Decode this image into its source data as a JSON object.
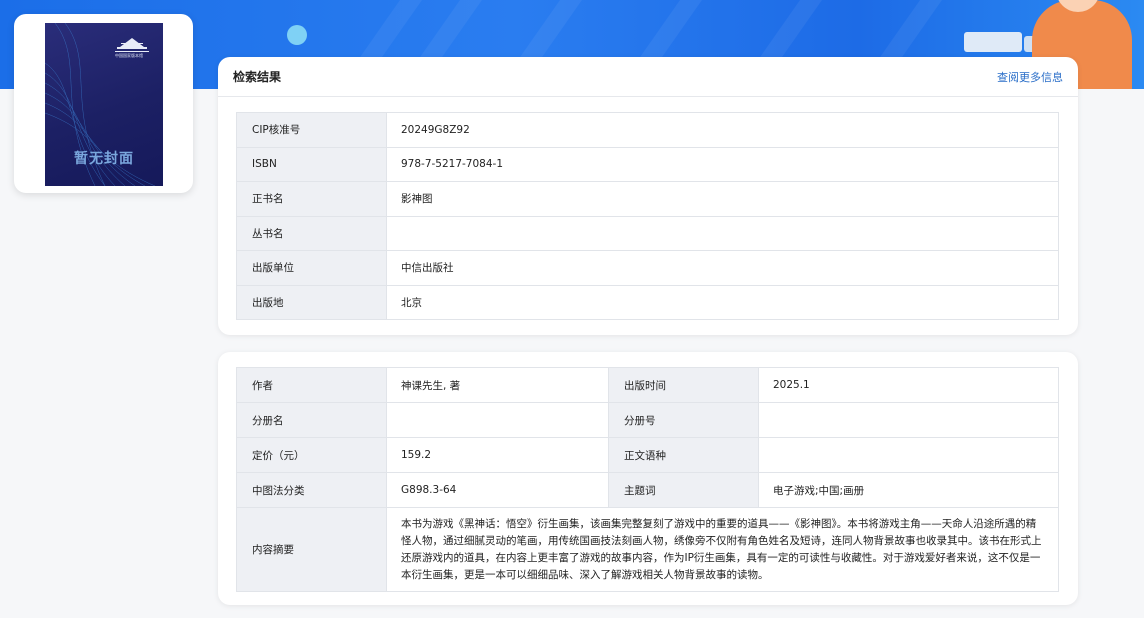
{
  "cover": {
    "placeholder_text": "暂无封面",
    "logo_text": "中国国家版本馆"
  },
  "results": {
    "title": "检索结果",
    "more_link": "查阅更多信息",
    "rows": [
      {
        "label": "CIP核准号",
        "value": "20249G8Z92"
      },
      {
        "label": "ISBN",
        "value": "978-7-5217-7084-1"
      },
      {
        "label": "正书名",
        "value": "影神图"
      },
      {
        "label": "丛书名",
        "value": ""
      },
      {
        "label": "出版单位",
        "value": "中信出版社"
      },
      {
        "label": "出版地",
        "value": "北京"
      }
    ]
  },
  "details": {
    "author_label": "作者",
    "author": "神课先生, 著",
    "pubdate_label": "出版时间",
    "pubdate": "2025.1",
    "volume_name_label": "分册名",
    "volume_name": "",
    "volume_no_label": "分册号",
    "volume_no": "",
    "price_label": "定价（元）",
    "price": "159.2",
    "language_label": "正文语种",
    "language": "",
    "clc_label": "中图法分类",
    "clc": "G898.3-64",
    "subject_label": "主题词",
    "subject": "电子游戏;中国;画册",
    "abstract_label": "内容摘要",
    "abstract": "本书为游戏《黑神话：悟空》衍生画集，该画集完整复刻了游戏中的重要的道具——《影神图》。本书将游戏主角——天命人沿途所遇的精怪人物，通过细腻灵动的笔画，用传统国画技法刻画人物，绣像旁不仅附有角色姓名及短诗，连同人物背景故事也收录其中。该书在形式上还原游戏内的道具，在内容上更丰富了游戏的故事内容，作为IP衍生画集，具有一定的可读性与收藏性。对于游戏爱好者来说，这不仅是一本衍生画集，更是一本可以细细品味、深入了解游戏相关人物背景故事的读物。"
  }
}
